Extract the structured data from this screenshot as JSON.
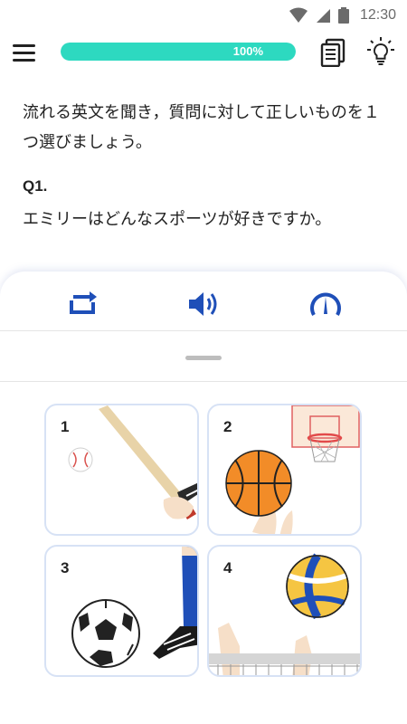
{
  "status_bar": {
    "time": "12:30",
    "icons": [
      "wifi-icon",
      "signal-icon",
      "battery-icon"
    ]
  },
  "header": {
    "menu_icon": "menu-icon",
    "progress": {
      "value": 1.0,
      "label": "100%"
    },
    "transcript_icon": "document-icon",
    "hint_icon": "lightbulb-icon"
  },
  "quiz": {
    "instruction": "流れる英文を聞き，質問に対して正しいものを１つ選びましょう。",
    "question_label": "Q1.",
    "question_text": "エミリーはどんなスポーツが好きですか。"
  },
  "controls": {
    "icons": [
      "repeat-icon",
      "speaker-icon",
      "speed-gauge-icon"
    ]
  },
  "options": [
    {
      "number": "1",
      "image": "baseball"
    },
    {
      "number": "2",
      "image": "basketball"
    },
    {
      "number": "3",
      "image": "soccer"
    },
    {
      "number": "4",
      "image": "volleyball"
    }
  ],
  "colors": {
    "accent_teal": "#2dd9c0",
    "control_blue": "#1f4fb8",
    "card_border": "#d7e2f5"
  }
}
